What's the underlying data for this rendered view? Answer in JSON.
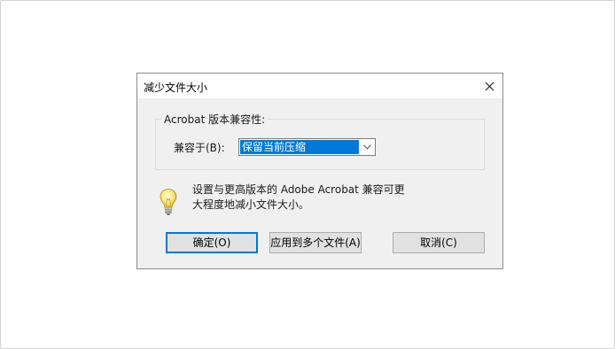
{
  "dialog": {
    "title": "减少文件大小",
    "close_icon": "close-icon",
    "group": {
      "label": "Acrobat 版本兼容性:",
      "field_label": "兼容于(B):",
      "combo_selected": "保留当前压缩",
      "combo_icon": "chevron-down-icon"
    },
    "info": {
      "icon": "lightbulb-icon",
      "lines": [
        "设置与更高版本的 Adobe Acrobat 兼容可更",
        "大程度地减小文件大小。"
      ]
    },
    "buttons": {
      "ok": "确定(O)",
      "apply_multiple": "应用到多个文件(A)",
      "cancel": "取消(C)"
    }
  }
}
